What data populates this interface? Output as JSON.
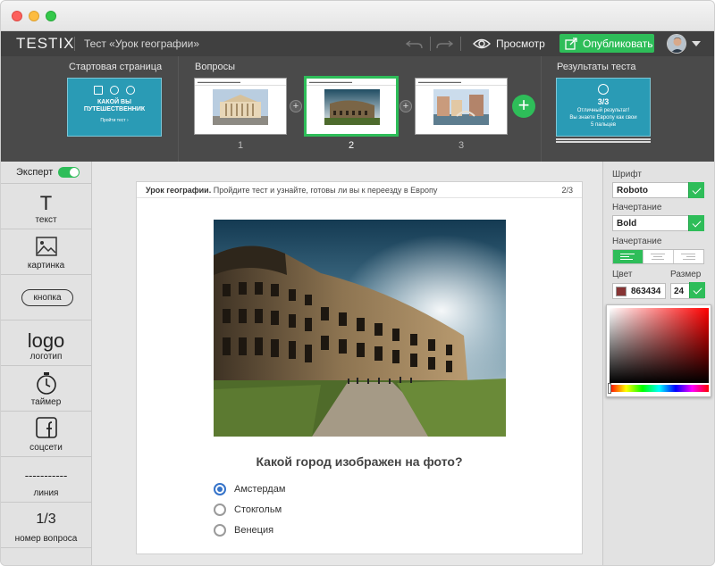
{
  "app": {
    "logo": "TESTIX",
    "doc_title": "Тест «Урок географии»",
    "preview_label": "Просмотр",
    "publish_label": "Опубликовать"
  },
  "strip": {
    "start_label": "Стартовая страница",
    "questions_label": "Вопросы",
    "results_label": "Результаты теста",
    "start_thumb": {
      "title": "КАКОЙ ВЫ ПУТЕШЕСТВЕННИК",
      "button": "Пройти тест ›"
    },
    "question_numbers": [
      "1",
      "2",
      "3"
    ],
    "result_thumb": {
      "score": "3/3",
      "line1": "Отличный результат!",
      "line2": "Вы знаете Европу как свои",
      "line3": "5 пальцев"
    }
  },
  "toolbar": {
    "expert_label": "Эксперт",
    "items": [
      {
        "glyph": "T",
        "label": "текст"
      },
      {
        "glyph": "",
        "label": "картинка"
      },
      {
        "glyph": "кнопка",
        "label": ""
      },
      {
        "glyph": "logo",
        "label": "логотип"
      },
      {
        "glyph": "",
        "label": "таймер"
      },
      {
        "glyph": "f",
        "label": "соцсети"
      },
      {
        "glyph": "-----------",
        "label": "линия"
      },
      {
        "glyph": "1/3",
        "label": "номер вопроса"
      }
    ]
  },
  "card": {
    "header_bold": "Урок географии.",
    "header_text": "Пройдите тест и узнайте, готовы ли вы к переезду в Европу",
    "page": "2/3",
    "question": "Какой город изображен на фото?",
    "options": [
      "Амстердам",
      "Стокгольм",
      "Венеция"
    ],
    "selected_index": 0
  },
  "panel": {
    "font_label": "Шрифт",
    "font_value": "Roboto",
    "weight_label": "Начертание",
    "weight_value": "Bold",
    "align_label": "Начертание",
    "color_label": "Цвет",
    "color_value": "863434",
    "size_label": "Размер",
    "size_value": "24"
  },
  "colors": {
    "accent": "#2ebd59",
    "teal": "#2a9bb5",
    "swatch": "#863434",
    "radio": "#3573c9"
  }
}
